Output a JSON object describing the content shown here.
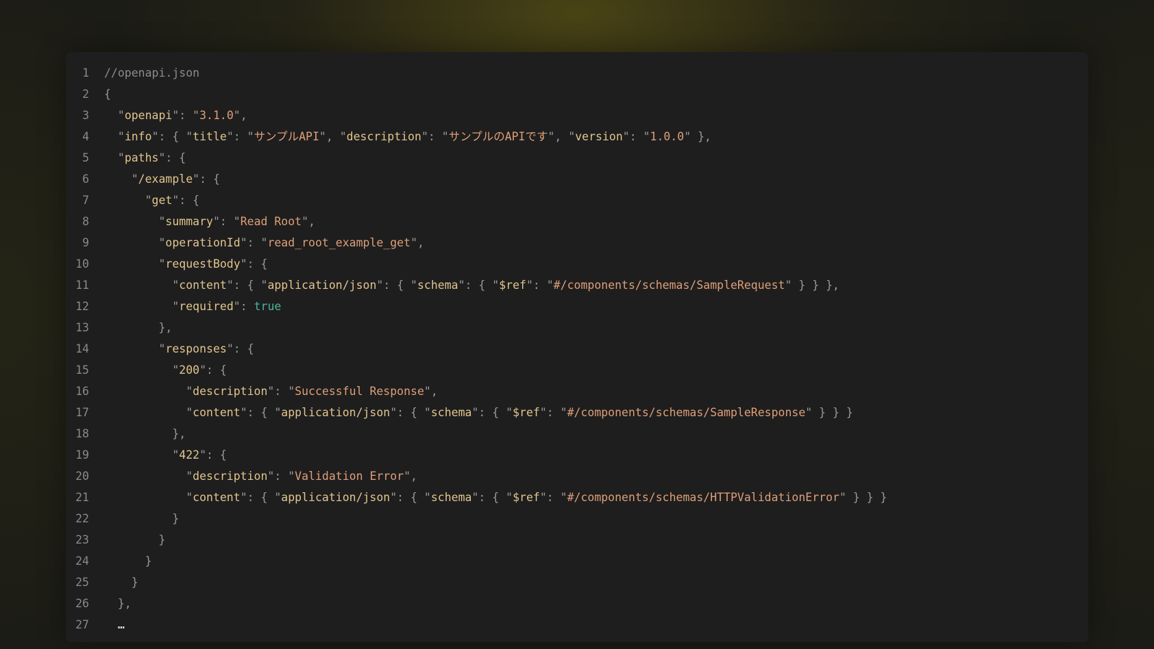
{
  "editor": {
    "lines": [
      {
        "n": "1",
        "tokens": [
          {
            "t": "c",
            "v": "//openapi.json"
          }
        ]
      },
      {
        "n": "2",
        "tokens": [
          {
            "t": "p",
            "v": "{"
          }
        ]
      },
      {
        "n": "3",
        "tokens": [
          {
            "t": "p",
            "v": "  \""
          },
          {
            "t": "k",
            "v": "openapi"
          },
          {
            "t": "p",
            "v": "\": "
          },
          {
            "t": "p",
            "v": "\""
          },
          {
            "t": "s",
            "v": "3.1.0"
          },
          {
            "t": "p",
            "v": "\","
          }
        ]
      },
      {
        "n": "4",
        "tokens": [
          {
            "t": "p",
            "v": "  \""
          },
          {
            "t": "k",
            "v": "info"
          },
          {
            "t": "p",
            "v": "\": { \""
          },
          {
            "t": "k",
            "v": "title"
          },
          {
            "t": "p",
            "v": "\": \""
          },
          {
            "t": "s",
            "v": "サンプルAPI"
          },
          {
            "t": "p",
            "v": "\", \""
          },
          {
            "t": "k",
            "v": "description"
          },
          {
            "t": "p",
            "v": "\": \""
          },
          {
            "t": "s",
            "v": "サンプルのAPIです"
          },
          {
            "t": "p",
            "v": "\", \""
          },
          {
            "t": "k",
            "v": "version"
          },
          {
            "t": "p",
            "v": "\": \""
          },
          {
            "t": "s",
            "v": "1.0.0"
          },
          {
            "t": "p",
            "v": "\" },"
          }
        ]
      },
      {
        "n": "5",
        "tokens": [
          {
            "t": "p",
            "v": "  \""
          },
          {
            "t": "k",
            "v": "paths"
          },
          {
            "t": "p",
            "v": "\": {"
          }
        ]
      },
      {
        "n": "6",
        "tokens": [
          {
            "t": "p",
            "v": "    \""
          },
          {
            "t": "k",
            "v": "/example"
          },
          {
            "t": "p",
            "v": "\": {"
          }
        ]
      },
      {
        "n": "7",
        "tokens": [
          {
            "t": "p",
            "v": "      \""
          },
          {
            "t": "k",
            "v": "get"
          },
          {
            "t": "p",
            "v": "\": {"
          }
        ]
      },
      {
        "n": "8",
        "tokens": [
          {
            "t": "p",
            "v": "        \""
          },
          {
            "t": "k",
            "v": "summary"
          },
          {
            "t": "p",
            "v": "\": \""
          },
          {
            "t": "s",
            "v": "Read Root"
          },
          {
            "t": "p",
            "v": "\","
          }
        ]
      },
      {
        "n": "9",
        "tokens": [
          {
            "t": "p",
            "v": "        \""
          },
          {
            "t": "k",
            "v": "operationId"
          },
          {
            "t": "p",
            "v": "\": \""
          },
          {
            "t": "s",
            "v": "read_root_example_get"
          },
          {
            "t": "p",
            "v": "\","
          }
        ]
      },
      {
        "n": "10",
        "tokens": [
          {
            "t": "p",
            "v": "        \""
          },
          {
            "t": "k",
            "v": "requestBody"
          },
          {
            "t": "p",
            "v": "\": {"
          }
        ]
      },
      {
        "n": "11",
        "tokens": [
          {
            "t": "p",
            "v": "          \""
          },
          {
            "t": "k",
            "v": "content"
          },
          {
            "t": "p",
            "v": "\": { \""
          },
          {
            "t": "k",
            "v": "application/json"
          },
          {
            "t": "p",
            "v": "\": { \""
          },
          {
            "t": "k",
            "v": "schema"
          },
          {
            "t": "p",
            "v": "\": { \""
          },
          {
            "t": "k",
            "v": "$ref"
          },
          {
            "t": "p",
            "v": "\": \""
          },
          {
            "t": "s",
            "v": "#/components/schemas/SampleRequest"
          },
          {
            "t": "p",
            "v": "\" } } },"
          }
        ]
      },
      {
        "n": "12",
        "tokens": [
          {
            "t": "p",
            "v": "          \""
          },
          {
            "t": "k",
            "v": "required"
          },
          {
            "t": "p",
            "v": "\": "
          },
          {
            "t": "b",
            "v": "true"
          }
        ]
      },
      {
        "n": "13",
        "tokens": [
          {
            "t": "p",
            "v": "        },"
          }
        ]
      },
      {
        "n": "14",
        "tokens": [
          {
            "t": "p",
            "v": "        \""
          },
          {
            "t": "k",
            "v": "responses"
          },
          {
            "t": "p",
            "v": "\": {"
          }
        ]
      },
      {
        "n": "15",
        "tokens": [
          {
            "t": "p",
            "v": "          \""
          },
          {
            "t": "k",
            "v": "200"
          },
          {
            "t": "p",
            "v": "\": {"
          }
        ]
      },
      {
        "n": "16",
        "tokens": [
          {
            "t": "p",
            "v": "            \""
          },
          {
            "t": "k",
            "v": "description"
          },
          {
            "t": "p",
            "v": "\": \""
          },
          {
            "t": "s",
            "v": "Successful Response"
          },
          {
            "t": "p",
            "v": "\","
          }
        ]
      },
      {
        "n": "17",
        "tokens": [
          {
            "t": "p",
            "v": "            \""
          },
          {
            "t": "k",
            "v": "content"
          },
          {
            "t": "p",
            "v": "\": { \""
          },
          {
            "t": "k",
            "v": "application/json"
          },
          {
            "t": "p",
            "v": "\": { \""
          },
          {
            "t": "k",
            "v": "schema"
          },
          {
            "t": "p",
            "v": "\": { \""
          },
          {
            "t": "k",
            "v": "$ref"
          },
          {
            "t": "p",
            "v": "\": \""
          },
          {
            "t": "s",
            "v": "#/components/schemas/SampleResponse"
          },
          {
            "t": "p",
            "v": "\" } } }"
          }
        ]
      },
      {
        "n": "18",
        "tokens": [
          {
            "t": "p",
            "v": "          },"
          }
        ]
      },
      {
        "n": "19",
        "tokens": [
          {
            "t": "p",
            "v": "          \""
          },
          {
            "t": "k",
            "v": "422"
          },
          {
            "t": "p",
            "v": "\": {"
          }
        ]
      },
      {
        "n": "20",
        "tokens": [
          {
            "t": "p",
            "v": "            \""
          },
          {
            "t": "k",
            "v": "description"
          },
          {
            "t": "p",
            "v": "\": \""
          },
          {
            "t": "s",
            "v": "Validation Error"
          },
          {
            "t": "p",
            "v": "\","
          }
        ]
      },
      {
        "n": "21",
        "tokens": [
          {
            "t": "p",
            "v": "            \""
          },
          {
            "t": "k",
            "v": "content"
          },
          {
            "t": "p",
            "v": "\": { \""
          },
          {
            "t": "k",
            "v": "application/json"
          },
          {
            "t": "p",
            "v": "\": { \""
          },
          {
            "t": "k",
            "v": "schema"
          },
          {
            "t": "p",
            "v": "\": { \""
          },
          {
            "t": "k",
            "v": "$ref"
          },
          {
            "t": "p",
            "v": "\": \""
          },
          {
            "t": "s",
            "v": "#/components/schemas/HTTPValidationError"
          },
          {
            "t": "p",
            "v": "\" } } }"
          }
        ]
      },
      {
        "n": "22",
        "tokens": [
          {
            "t": "p",
            "v": "          }"
          }
        ]
      },
      {
        "n": "23",
        "tokens": [
          {
            "t": "p",
            "v": "        }"
          }
        ]
      },
      {
        "n": "24",
        "tokens": [
          {
            "t": "p",
            "v": "      }"
          }
        ]
      },
      {
        "n": "25",
        "tokens": [
          {
            "t": "p",
            "v": "    }"
          }
        ]
      },
      {
        "n": "26",
        "tokens": [
          {
            "t": "p",
            "v": "  },"
          }
        ]
      },
      {
        "n": "27",
        "tokens": [
          {
            "t": "p",
            "v": "  "
          },
          {
            "t": "e",
            "v": "…"
          }
        ]
      }
    ]
  }
}
